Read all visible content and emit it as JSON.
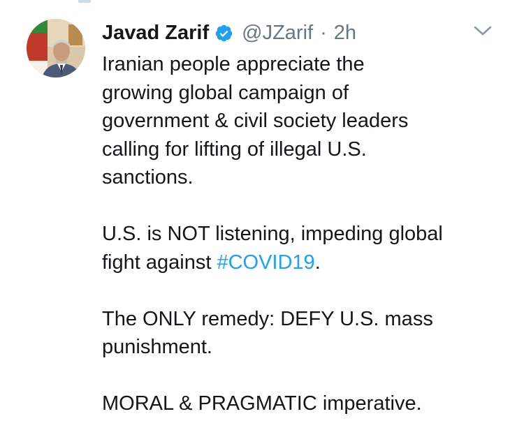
{
  "tweet": {
    "author": {
      "display_name": "Javad Zarif",
      "handle": "@JZarif",
      "verified": true,
      "avatar": "profile-photo"
    },
    "separator": "·",
    "time": "2h",
    "menu_icon": "chevron-down-icon",
    "paragraphs": [
      [
        "Iranian people appreciate the",
        "growing global campaign of",
        "government & civil society leaders",
        "calling for lifting of illegal U.S.",
        "sanctions."
      ],
      [
        "U.S. is NOT listening, impeding global"
      ],
      [
        "The ONLY remedy: DEFY U.S. mass",
        "punishment."
      ],
      [
        "MORAL & PRAGMATIC imperative."
      ]
    ],
    "p2_line2_prefix": "fight against ",
    "hashtag": "#COVID19",
    "p2_line2_suffix": "."
  },
  "colors": {
    "text": "#14171a",
    "secondary": "#657786",
    "link": "#1da1f2",
    "verified_badge": "#1da1f2"
  }
}
